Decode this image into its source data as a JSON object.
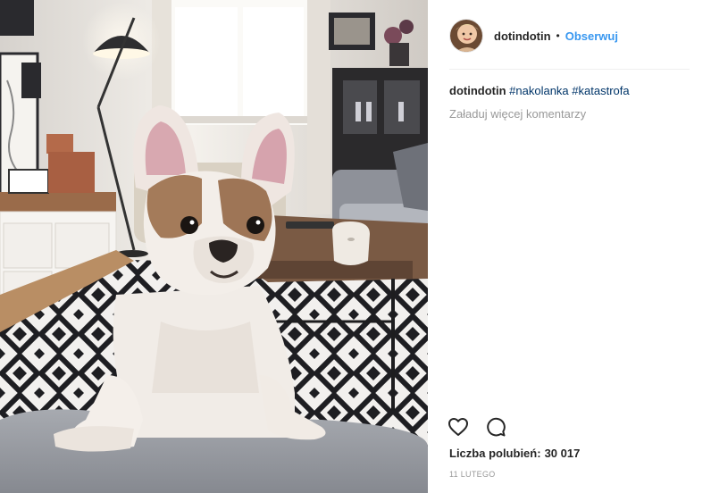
{
  "post": {
    "author": {
      "username": "dotindotin",
      "follow_label": "Obserwuj",
      "separator": "•"
    },
    "caption": {
      "username": "dotindotin",
      "hashtags": [
        "#nakolanka",
        "#katastrofa"
      ]
    },
    "load_more_comments": "Załaduj więcej komentarzy",
    "actions": {
      "like_icon": "heart-outline-icon",
      "comment_icon": "speech-bubble-icon"
    },
    "likes": {
      "label": "Liczba polubień:",
      "count": "30 017"
    },
    "date": "11 LUTEGO",
    "photo": {
      "subject": "french-bulldog"
    }
  },
  "colors": {
    "link": "#3897f0",
    "hashtag": "#003569",
    "muted": "#999999",
    "text": "#262626",
    "divider": "#efefef"
  }
}
